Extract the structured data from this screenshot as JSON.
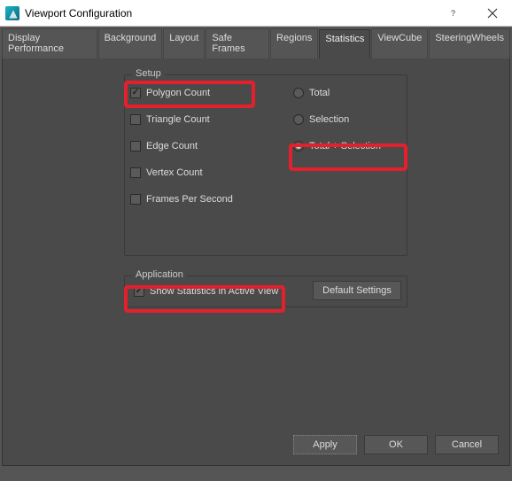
{
  "window": {
    "title": "Viewport Configuration"
  },
  "tabs": {
    "t0": "Display Performance",
    "t1": "Background",
    "t2": "Layout",
    "t3": "Safe Frames",
    "t4": "Regions",
    "t5": "Statistics",
    "t6": "ViewCube",
    "t7": "SteeringWheels"
  },
  "setup": {
    "legend": "Setup",
    "polygon": "Polygon Count",
    "triangle": "Triangle Count",
    "edge": "Edge Count",
    "vertex": "Vertex Count",
    "fps": "Frames Per Second",
    "total": "Total",
    "selection": "Selection",
    "totalSel": "Total + Selection"
  },
  "application": {
    "legend": "Application",
    "showStats": "Show Statistics in Active View"
  },
  "buttons": {
    "defaults": "Default Settings",
    "apply": "Apply",
    "ok": "OK",
    "cancel": "Cancel"
  }
}
